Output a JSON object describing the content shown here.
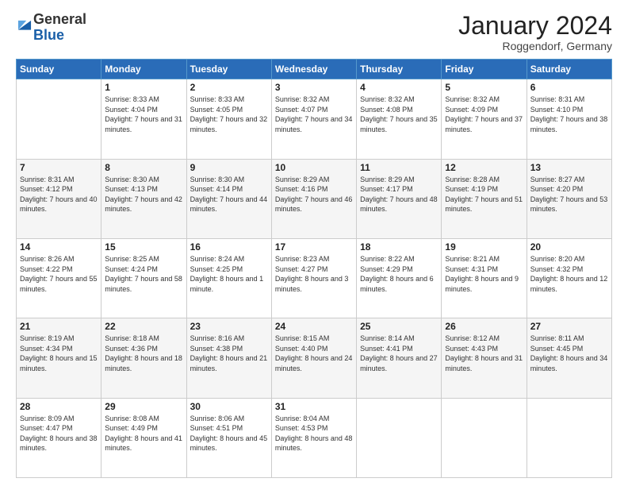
{
  "header": {
    "logo_general": "General",
    "logo_blue": "Blue",
    "month_title": "January 2024",
    "location": "Roggendorf, Germany"
  },
  "weekdays": [
    "Sunday",
    "Monday",
    "Tuesday",
    "Wednesday",
    "Thursday",
    "Friday",
    "Saturday"
  ],
  "weeks": [
    [
      {
        "day": "",
        "sunrise": "",
        "sunset": "",
        "daylight": ""
      },
      {
        "day": "1",
        "sunrise": "Sunrise: 8:33 AM",
        "sunset": "Sunset: 4:04 PM",
        "daylight": "Daylight: 7 hours and 31 minutes."
      },
      {
        "day": "2",
        "sunrise": "Sunrise: 8:33 AM",
        "sunset": "Sunset: 4:05 PM",
        "daylight": "Daylight: 7 hours and 32 minutes."
      },
      {
        "day": "3",
        "sunrise": "Sunrise: 8:32 AM",
        "sunset": "Sunset: 4:07 PM",
        "daylight": "Daylight: 7 hours and 34 minutes."
      },
      {
        "day": "4",
        "sunrise": "Sunrise: 8:32 AM",
        "sunset": "Sunset: 4:08 PM",
        "daylight": "Daylight: 7 hours and 35 minutes."
      },
      {
        "day": "5",
        "sunrise": "Sunrise: 8:32 AM",
        "sunset": "Sunset: 4:09 PM",
        "daylight": "Daylight: 7 hours and 37 minutes."
      },
      {
        "day": "6",
        "sunrise": "Sunrise: 8:31 AM",
        "sunset": "Sunset: 4:10 PM",
        "daylight": "Daylight: 7 hours and 38 minutes."
      }
    ],
    [
      {
        "day": "7",
        "sunrise": "Sunrise: 8:31 AM",
        "sunset": "Sunset: 4:12 PM",
        "daylight": "Daylight: 7 hours and 40 minutes."
      },
      {
        "day": "8",
        "sunrise": "Sunrise: 8:30 AM",
        "sunset": "Sunset: 4:13 PM",
        "daylight": "Daylight: 7 hours and 42 minutes."
      },
      {
        "day": "9",
        "sunrise": "Sunrise: 8:30 AM",
        "sunset": "Sunset: 4:14 PM",
        "daylight": "Daylight: 7 hours and 44 minutes."
      },
      {
        "day": "10",
        "sunrise": "Sunrise: 8:29 AM",
        "sunset": "Sunset: 4:16 PM",
        "daylight": "Daylight: 7 hours and 46 minutes."
      },
      {
        "day": "11",
        "sunrise": "Sunrise: 8:29 AM",
        "sunset": "Sunset: 4:17 PM",
        "daylight": "Daylight: 7 hours and 48 minutes."
      },
      {
        "day": "12",
        "sunrise": "Sunrise: 8:28 AM",
        "sunset": "Sunset: 4:19 PM",
        "daylight": "Daylight: 7 hours and 51 minutes."
      },
      {
        "day": "13",
        "sunrise": "Sunrise: 8:27 AM",
        "sunset": "Sunset: 4:20 PM",
        "daylight": "Daylight: 7 hours and 53 minutes."
      }
    ],
    [
      {
        "day": "14",
        "sunrise": "Sunrise: 8:26 AM",
        "sunset": "Sunset: 4:22 PM",
        "daylight": "Daylight: 7 hours and 55 minutes."
      },
      {
        "day": "15",
        "sunrise": "Sunrise: 8:25 AM",
        "sunset": "Sunset: 4:24 PM",
        "daylight": "Daylight: 7 hours and 58 minutes."
      },
      {
        "day": "16",
        "sunrise": "Sunrise: 8:24 AM",
        "sunset": "Sunset: 4:25 PM",
        "daylight": "Daylight: 8 hours and 1 minute."
      },
      {
        "day": "17",
        "sunrise": "Sunrise: 8:23 AM",
        "sunset": "Sunset: 4:27 PM",
        "daylight": "Daylight: 8 hours and 3 minutes."
      },
      {
        "day": "18",
        "sunrise": "Sunrise: 8:22 AM",
        "sunset": "Sunset: 4:29 PM",
        "daylight": "Daylight: 8 hours and 6 minutes."
      },
      {
        "day": "19",
        "sunrise": "Sunrise: 8:21 AM",
        "sunset": "Sunset: 4:31 PM",
        "daylight": "Daylight: 8 hours and 9 minutes."
      },
      {
        "day": "20",
        "sunrise": "Sunrise: 8:20 AM",
        "sunset": "Sunset: 4:32 PM",
        "daylight": "Daylight: 8 hours and 12 minutes."
      }
    ],
    [
      {
        "day": "21",
        "sunrise": "Sunrise: 8:19 AM",
        "sunset": "Sunset: 4:34 PM",
        "daylight": "Daylight: 8 hours and 15 minutes."
      },
      {
        "day": "22",
        "sunrise": "Sunrise: 8:18 AM",
        "sunset": "Sunset: 4:36 PM",
        "daylight": "Daylight: 8 hours and 18 minutes."
      },
      {
        "day": "23",
        "sunrise": "Sunrise: 8:16 AM",
        "sunset": "Sunset: 4:38 PM",
        "daylight": "Daylight: 8 hours and 21 minutes."
      },
      {
        "day": "24",
        "sunrise": "Sunrise: 8:15 AM",
        "sunset": "Sunset: 4:40 PM",
        "daylight": "Daylight: 8 hours and 24 minutes."
      },
      {
        "day": "25",
        "sunrise": "Sunrise: 8:14 AM",
        "sunset": "Sunset: 4:41 PM",
        "daylight": "Daylight: 8 hours and 27 minutes."
      },
      {
        "day": "26",
        "sunrise": "Sunrise: 8:12 AM",
        "sunset": "Sunset: 4:43 PM",
        "daylight": "Daylight: 8 hours and 31 minutes."
      },
      {
        "day": "27",
        "sunrise": "Sunrise: 8:11 AM",
        "sunset": "Sunset: 4:45 PM",
        "daylight": "Daylight: 8 hours and 34 minutes."
      }
    ],
    [
      {
        "day": "28",
        "sunrise": "Sunrise: 8:09 AM",
        "sunset": "Sunset: 4:47 PM",
        "daylight": "Daylight: 8 hours and 38 minutes."
      },
      {
        "day": "29",
        "sunrise": "Sunrise: 8:08 AM",
        "sunset": "Sunset: 4:49 PM",
        "daylight": "Daylight: 8 hours and 41 minutes."
      },
      {
        "day": "30",
        "sunrise": "Sunrise: 8:06 AM",
        "sunset": "Sunset: 4:51 PM",
        "daylight": "Daylight: 8 hours and 45 minutes."
      },
      {
        "day": "31",
        "sunrise": "Sunrise: 8:04 AM",
        "sunset": "Sunset: 4:53 PM",
        "daylight": "Daylight: 8 hours and 48 minutes."
      },
      {
        "day": "",
        "sunrise": "",
        "sunset": "",
        "daylight": ""
      },
      {
        "day": "",
        "sunrise": "",
        "sunset": "",
        "daylight": ""
      },
      {
        "day": "",
        "sunrise": "",
        "sunset": "",
        "daylight": ""
      }
    ]
  ]
}
